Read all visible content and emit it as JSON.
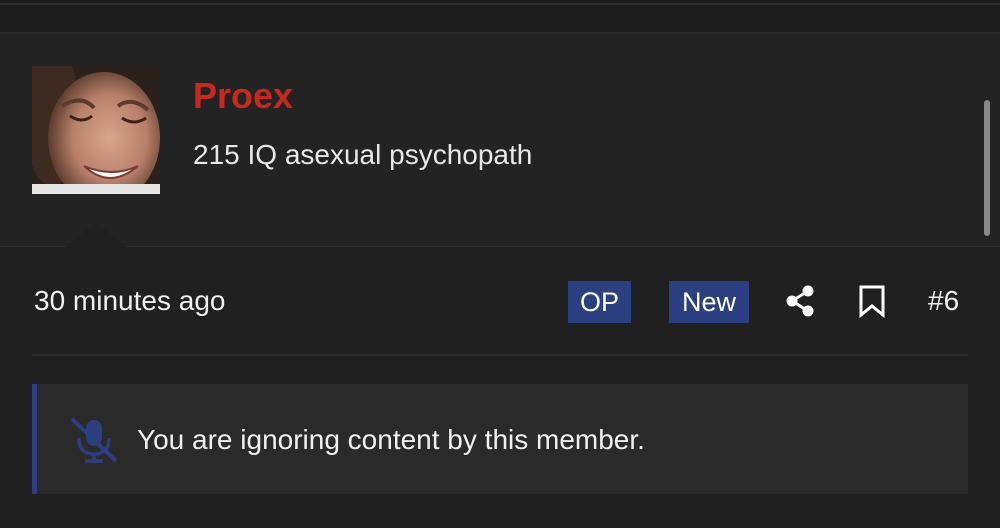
{
  "post": {
    "username": "Proex",
    "user_title": "215 IQ asexual psychopath",
    "avatar_icon": "user-avatar-photo",
    "timestamp": "30 minutes ago",
    "badges": {
      "op": "OP",
      "new": "New"
    },
    "post_number": "#6",
    "share_icon": "share-icon",
    "bookmark_icon": "bookmark-icon"
  },
  "notice": {
    "icon": "muted-microphone-icon",
    "text": "You are ignoring content by this member."
  },
  "colors": {
    "background": "#202020",
    "username": "#c9281e",
    "badge_bg": "#2c3f80",
    "notice_bg": "#2a2a2a",
    "text": "#f0f0f0"
  }
}
